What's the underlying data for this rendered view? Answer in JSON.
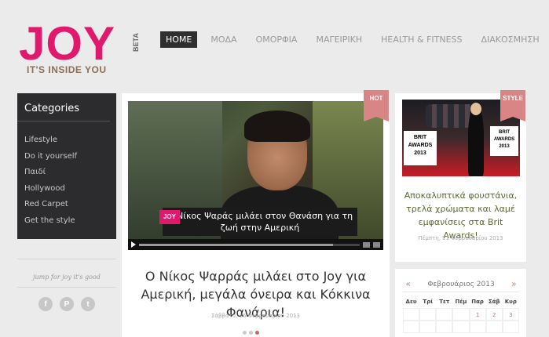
{
  "logo": {
    "word": "JOY",
    "beta": "BETA",
    "tagline": "IT'S INSIDE YOU"
  },
  "nav": [
    {
      "label": "HOME",
      "active": true
    },
    {
      "label": "ΜΟΔΑ"
    },
    {
      "label": "ΟΜΟΡΦΙΑ"
    },
    {
      "label": "ΜΑΓΕΙΡΙΚΗ"
    },
    {
      "label": "HEALTH & FITNESS"
    },
    {
      "label": "ΔΙΑΚΟΣΜΗΣΗ"
    }
  ],
  "sidebar": {
    "title": "Categories",
    "items": [
      {
        "label": "Lifestyle"
      },
      {
        "label": "Do it yourself"
      },
      {
        "label": "Παιδί"
      },
      {
        "label": "Hollywood"
      },
      {
        "label": "Red Carpet"
      },
      {
        "label": "Get the style"
      }
    ],
    "handwriting": "jump for joy it's good",
    "socials": [
      {
        "icon": "facebook-icon",
        "glyph": "f"
      },
      {
        "icon": "pinterest-icon",
        "glyph": "P"
      },
      {
        "icon": "twitter-icon",
        "glyph": "t"
      }
    ]
  },
  "main": {
    "ribbon": "HOT",
    "video": {
      "subtitle_logo": "JOY",
      "subtitle": "Ο Νίκος Ψαράς μιλάει στον Θανάση για τη ζωή στην Αμερική",
      "progress": 0.88
    },
    "title": "Ο Νίκος Ψαρράς μιλάει στο Joy για Αμερική, μεγάλα όνειρα και Κόκκινα Φανάρια!",
    "date": "Σάββατο, 16 Φεβρουαρίου 2013",
    "slides": 3,
    "active_slide": 3
  },
  "side_story": {
    "ribbon": "STYLE",
    "image_text_left": "BRIT AWARDS 2013",
    "image_text_right": "BRIT AWARDS 2013",
    "title": "Αποκαλυπτικά φουστάνια, τρελά χρώματα και λαμέ εμφανίσεις στα Brit Awards!",
    "date": "Πέμπτη, 21 Φεβρουαρίου 2013"
  },
  "calendar": {
    "prev": "«",
    "next": "»",
    "month": "Φεβρουάριος 2013",
    "weekdays": [
      "Δευ",
      "Τρί",
      "Τετ",
      "Πέμ",
      "Παρ",
      "Σάβ",
      "Κυρ"
    ],
    "rows": [
      [
        "",
        "",
        "",
        "",
        "1",
        "2",
        "3"
      ],
      [
        "",
        "",
        "",
        "",
        "",
        "",
        ""
      ]
    ]
  },
  "colors": {
    "brand_pink": "#e0196d",
    "ribbon": "#d98585",
    "link_green": "#5a6b32"
  }
}
